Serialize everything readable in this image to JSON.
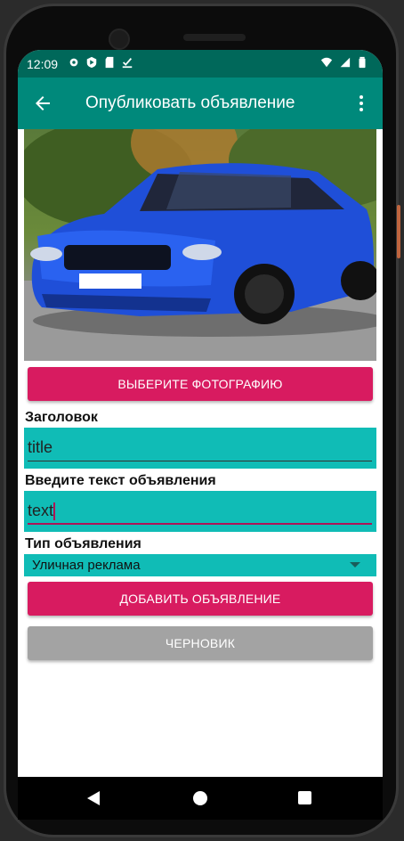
{
  "status": {
    "time": "12:09"
  },
  "appbar": {
    "title": "Опубликовать объявление"
  },
  "buttons": {
    "choose_photo": "ВЫБЕРИТЕ ФОТОГРАФИЮ",
    "add_ad": "ДОБАВИТЬ ОБЪЯВЛЕНИЕ",
    "draft": "ЧЕРНОВИК"
  },
  "form": {
    "title_label": "Заголовок",
    "title_value": "title",
    "text_label": "Введите текст объявления",
    "text_value": "text",
    "type_label": "Тип объявления",
    "type_selected": "Уличная реклама"
  },
  "colors": {
    "statusbar": "#00685a",
    "appbar": "#00897b",
    "accent": "#d81b60",
    "field": "#10bcb6",
    "draft": "#a3a3a3"
  },
  "icons": {
    "back": "arrow-left",
    "menu": "more-vert",
    "status_left": [
      "settings-gear",
      "play-protect",
      "sd-card",
      "download-check"
    ],
    "status_right": [
      "wifi",
      "cell-signal",
      "battery"
    ]
  }
}
